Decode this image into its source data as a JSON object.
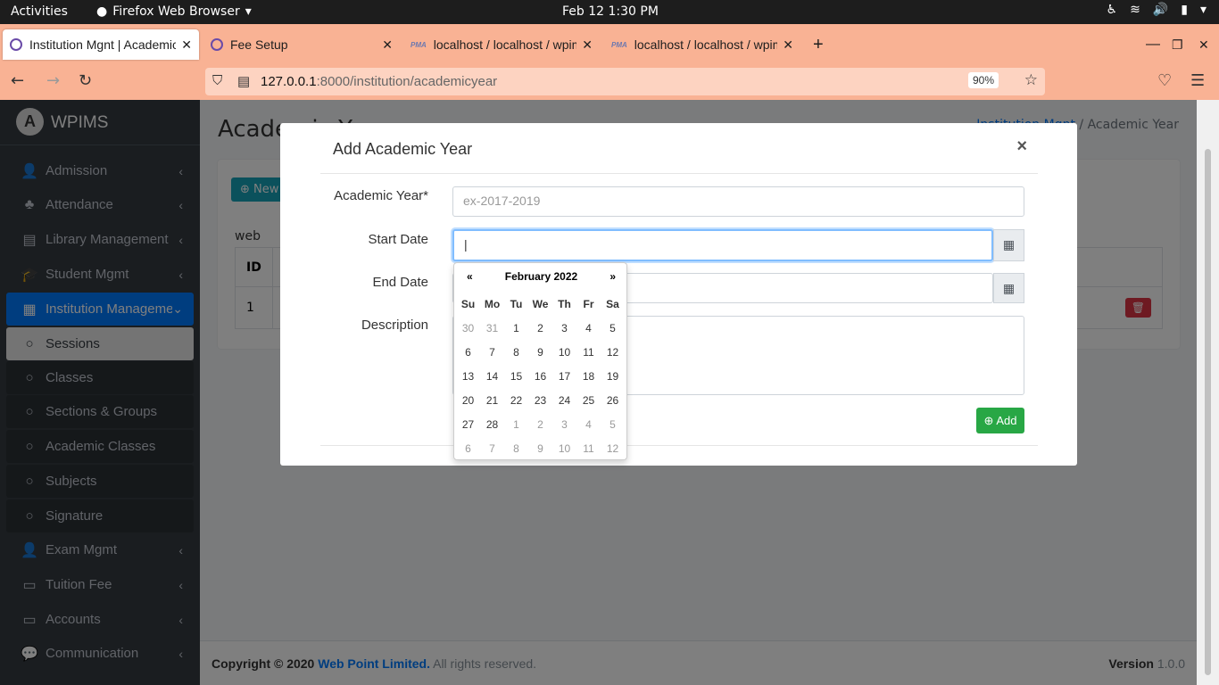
{
  "system": {
    "activities": "Activities",
    "app": "Firefox Web Browser",
    "clock": "Feb 12  1:30 PM"
  },
  "tabs": [
    {
      "title": "Institution Mgnt | Academic Year"
    },
    {
      "title": "Fee Setup"
    },
    {
      "title": "localhost / localhost / wpims"
    },
    {
      "title": "localhost / localhost / wpims"
    }
  ],
  "browser": {
    "url_host": "127.0.0.1",
    "url_rest": ":8000/institution/academicyear",
    "zoom": "90%"
  },
  "sidebar": {
    "brand": "WPIMS",
    "items": [
      {
        "label": "Admission",
        "icon": "user-plus-icon"
      },
      {
        "label": "Attendance",
        "icon": "tree-icon"
      },
      {
        "label": "Library Management",
        "icon": "book-icon"
      },
      {
        "label": "Student Mgmt",
        "icon": "graduation-cap-icon"
      },
      {
        "label": "Institution Management",
        "icon": "table-icon"
      },
      {
        "label": "Sessions",
        "icon": "circle-icon"
      },
      {
        "label": "Classes",
        "icon": "circle-icon"
      },
      {
        "label": "Sections & Groups",
        "icon": "circle-icon"
      },
      {
        "label": "Academic Classes",
        "icon": "circle-icon"
      },
      {
        "label": "Subjects",
        "icon": "circle-icon"
      },
      {
        "label": "Signature",
        "icon": "circle-icon"
      },
      {
        "label": "Exam Mgmt",
        "icon": "user-tie-icon"
      },
      {
        "label": "Tuition Fee",
        "icon": "money-icon"
      },
      {
        "label": "Accounts",
        "icon": "money-icon"
      },
      {
        "label": "Communication",
        "icon": "comments-icon"
      }
    ]
  },
  "page": {
    "title": "Academic Year",
    "crumb_link": "Institution Mgnt",
    "crumb_sep": "/",
    "crumb_current": "Academic Year",
    "new_btn": "New",
    "web": "web",
    "col_id": "ID",
    "row1_id": "1"
  },
  "footer": {
    "copyright": "Copyright © 2020",
    "company": "Web Point Limited.",
    "rights": "All rights reserved.",
    "version_label": "Version",
    "version": "1.0.0"
  },
  "modal": {
    "title": "Add Academic Year",
    "close": "×",
    "academic_year_label": "Academic Year*",
    "academic_year_placeholder": "ex-2017-2019",
    "start_date_label": "Start Date",
    "end_date_label": "End Date",
    "description_label": "Description",
    "add_button": "Add"
  },
  "calendar": {
    "month": "February 2022",
    "prev": "«",
    "next": "»",
    "dow": [
      "Su",
      "Mo",
      "Tu",
      "We",
      "Th",
      "Fr",
      "Sa"
    ],
    "weeks": [
      [
        "30",
        "31",
        "1",
        "2",
        "3",
        "4",
        "5"
      ],
      [
        "6",
        "7",
        "8",
        "9",
        "10",
        "11",
        "12"
      ],
      [
        "13",
        "14",
        "15",
        "16",
        "17",
        "18",
        "19"
      ],
      [
        "20",
        "21",
        "22",
        "23",
        "24",
        "25",
        "26"
      ],
      [
        "27",
        "28",
        "1",
        "2",
        "3",
        "4",
        "5"
      ],
      [
        "6",
        "7",
        "8",
        "9",
        "10",
        "11",
        "12"
      ]
    ]
  }
}
